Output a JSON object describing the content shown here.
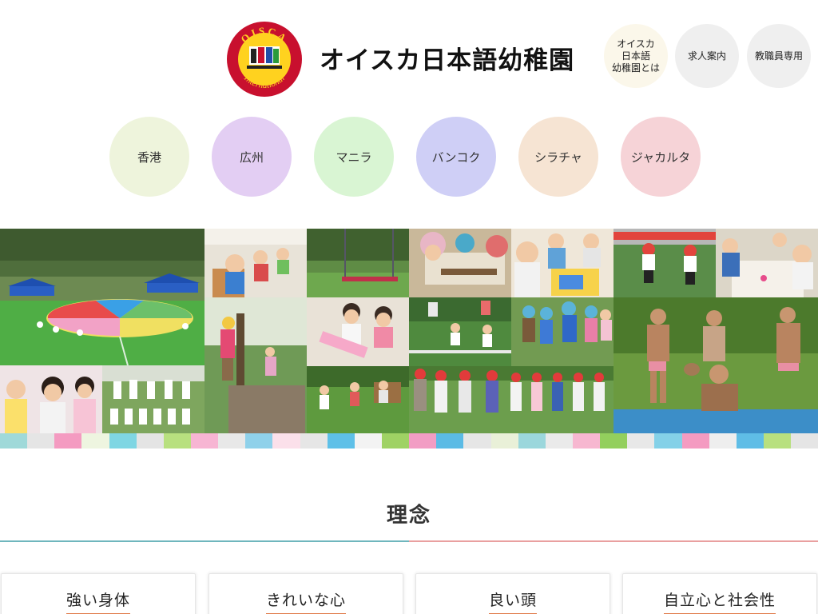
{
  "header": {
    "logo_text_top": "OISCA",
    "logo_text_bottom": "International",
    "site_title": "オイスカ日本語幼稚園",
    "nav": [
      {
        "label": "オイスカ\n日本語\n幼稚園とは"
      },
      {
        "label": "求人案内"
      },
      {
        "label": "教職員専用"
      }
    ]
  },
  "branches": [
    {
      "label": "香港",
      "color": "#eef4dc"
    },
    {
      "label": "広州",
      "color": "#e3cef3"
    },
    {
      "label": "マニラ",
      "color": "#d9f5d3"
    },
    {
      "label": "バンコク",
      "color": "#cfcff6"
    },
    {
      "label": "シラチャ",
      "color": "#f6e4d3"
    },
    {
      "label": "ジャカルタ",
      "color": "#f6d3d7"
    }
  ],
  "philosophy": {
    "title": "理念",
    "cards": [
      {
        "title": "強い身体"
      },
      {
        "title": "きれいな心"
      },
      {
        "title": "良い頭"
      },
      {
        "title": "自立心と社会性"
      }
    ]
  },
  "colors": {
    "accent_underline": "#e07a49",
    "rule_teal": "#6fb6bd",
    "rule_pink": "#e9a0a0"
  }
}
